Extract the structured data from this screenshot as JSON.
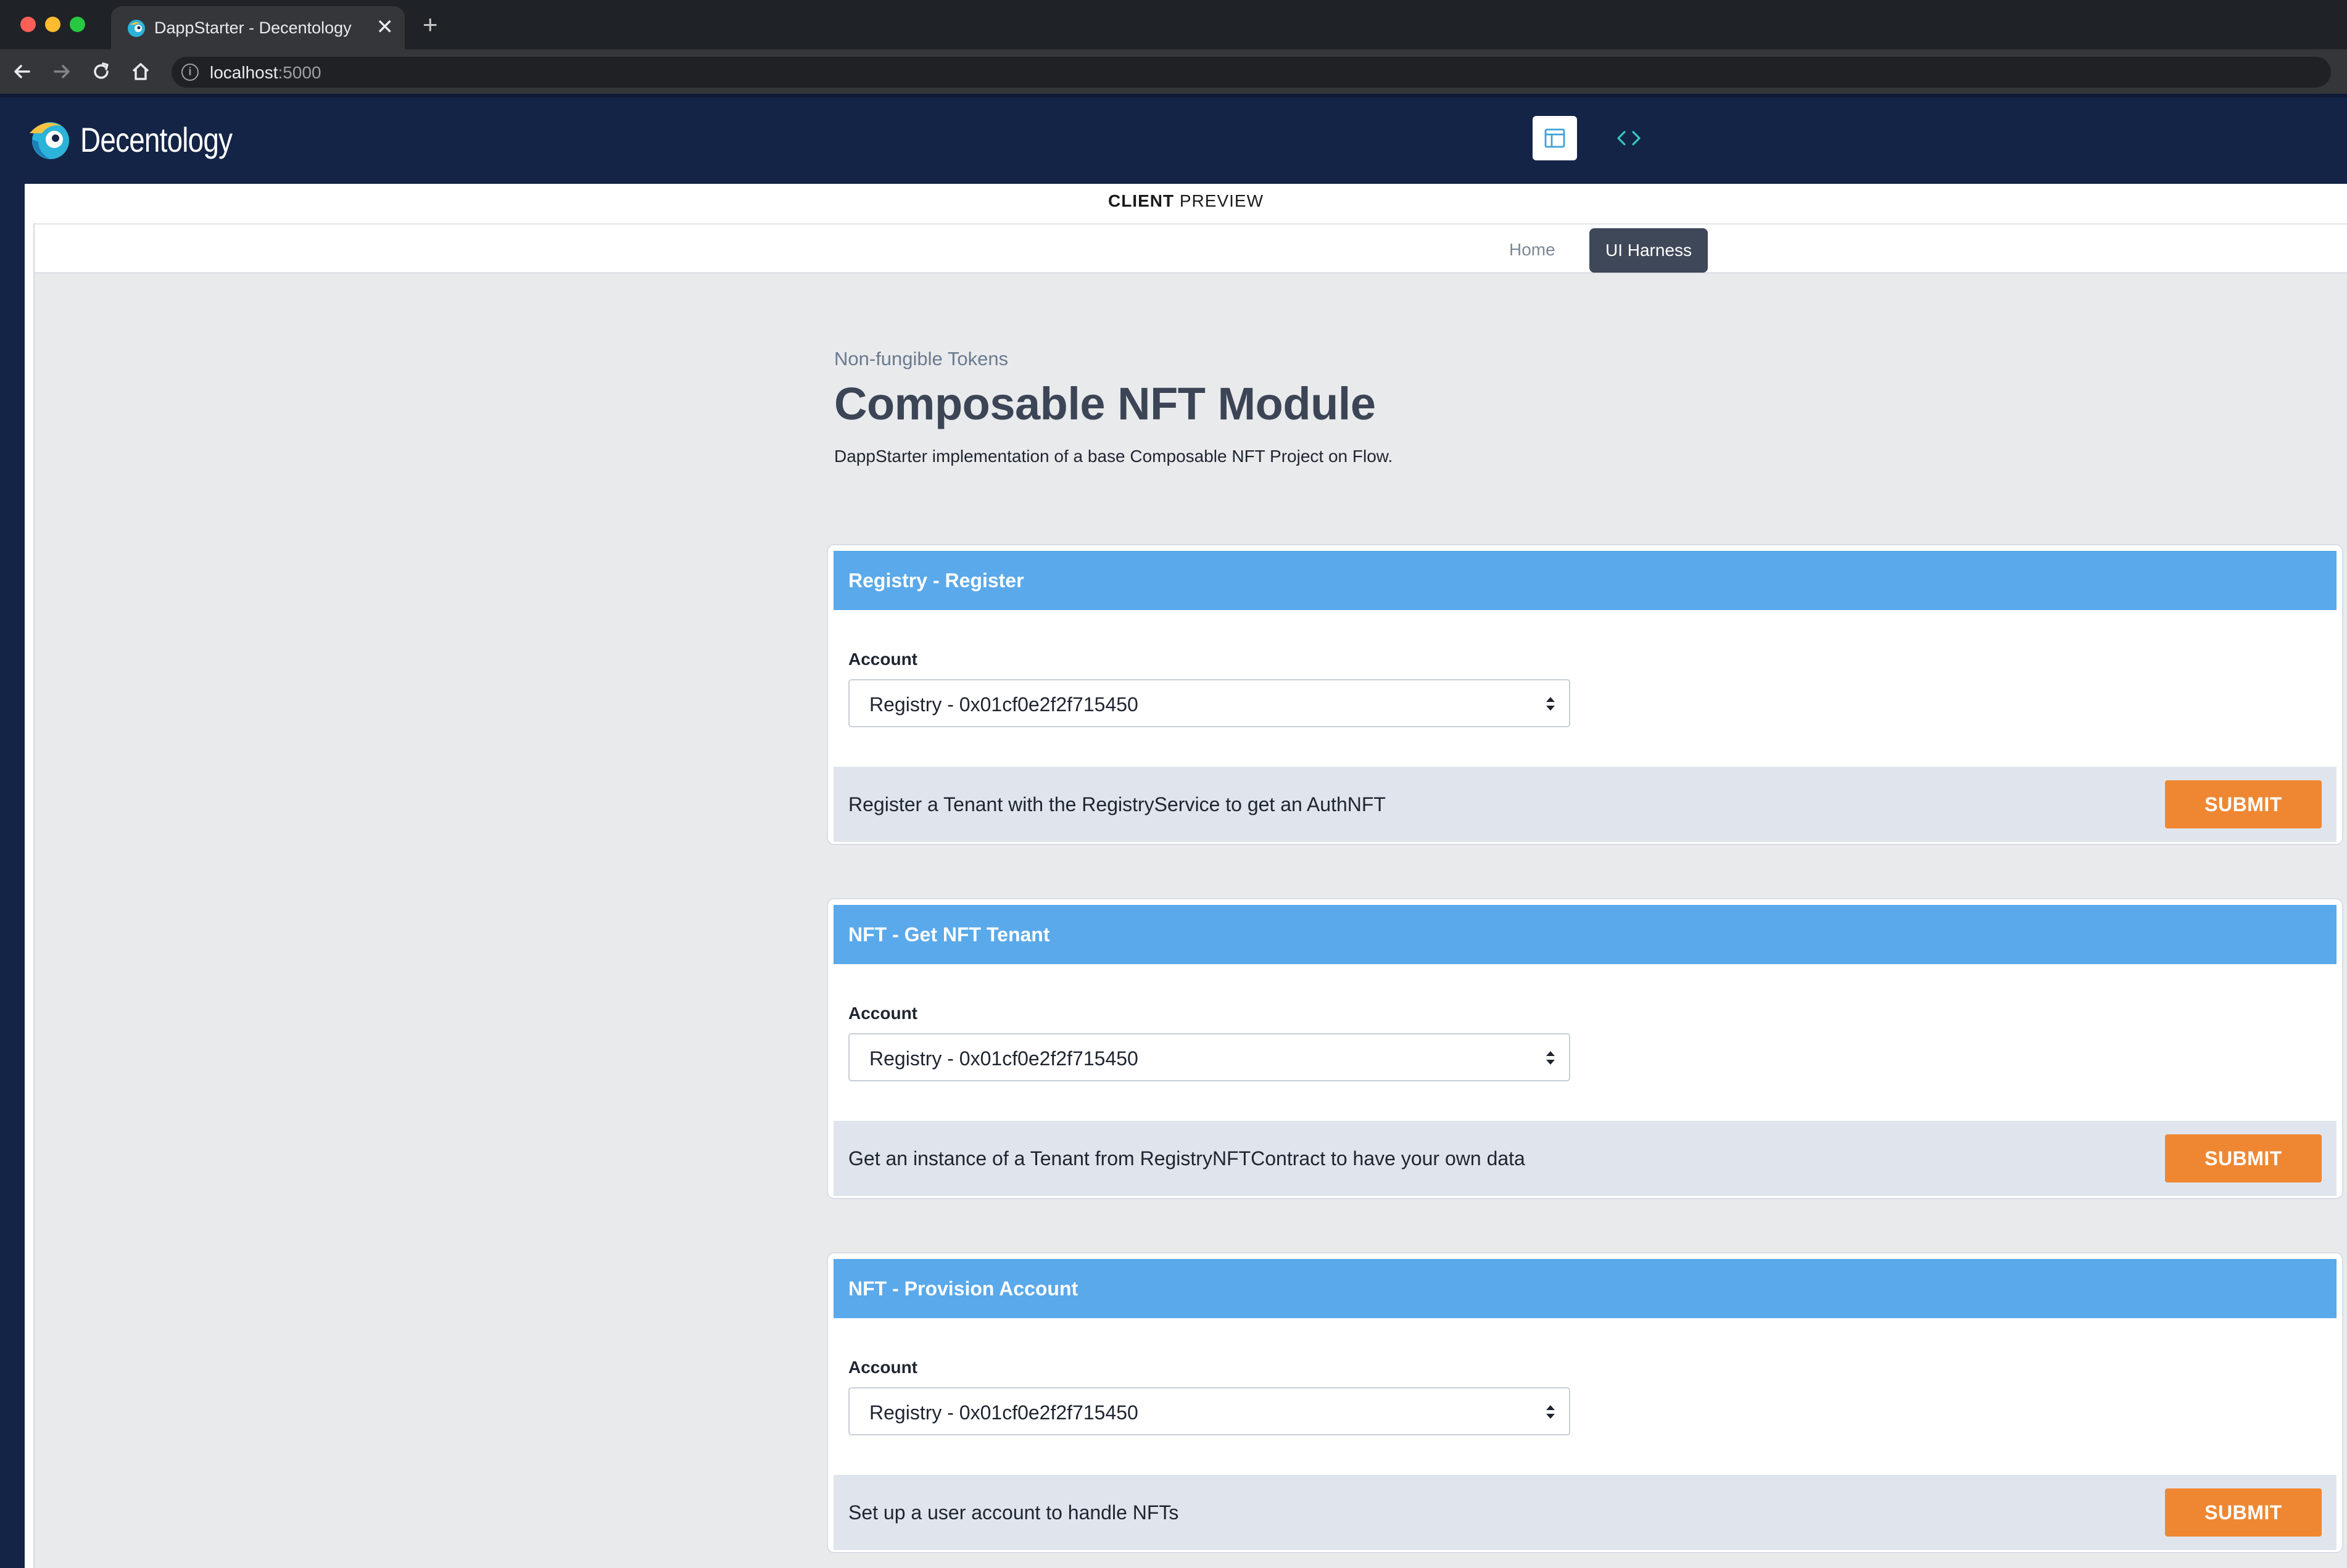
{
  "browser": {
    "tab_title": "DappStarter - Decentology",
    "tab_close": "✕",
    "new_tab": "+",
    "url_host": "localhost",
    "url_port": ":5000"
  },
  "header": {
    "logo_text": "Decentology"
  },
  "preview": {
    "label_bold": "CLIENT",
    "label_rest": " PREVIEW",
    "nav": {
      "home": "Home",
      "harness": "UI Harness"
    }
  },
  "page": {
    "eyebrow": "Non-fungible Tokens",
    "title": "Composable NFT Module",
    "description": "DappStarter implementation of a base Composable NFT Project on Flow."
  },
  "cards": [
    {
      "title": "Registry - Register",
      "field_label": "Account",
      "selected_account": "Registry - 0x01cf0e2f2f715450",
      "description": "Register a Tenant with the RegistryService to get an AuthNFT",
      "submit_label": "SUBMIT"
    },
    {
      "title": "NFT - Get NFT Tenant",
      "field_label": "Account",
      "selected_account": "Registry - 0x01cf0e2f2f715450",
      "description": "Get an instance of a Tenant from RegistryNFTContract to have your own data",
      "submit_label": "SUBMIT"
    },
    {
      "title": "NFT - Provision Account",
      "field_label": "Account",
      "selected_account": "Registry - 0x01cf0e2f2f715450",
      "description": "Set up a user account to handle NFTs",
      "submit_label": "SUBMIT"
    }
  ],
  "icons": {
    "favicon": "decentology-favicon-icon",
    "back": "arrow-left-icon",
    "forward": "arrow-right-icon",
    "reload": "reload-icon",
    "home": "home-icon",
    "info": "info-icon",
    "preview": "layout-preview-icon",
    "code": "code-brackets-icon",
    "select_arrow": "select-arrows-icon"
  },
  "colors": {
    "app_header": "#142446",
    "card_header": "#5aa9ea",
    "submit": "#ef8732",
    "active_nav": "#3f4859",
    "content_bg": "#e9eaec"
  }
}
